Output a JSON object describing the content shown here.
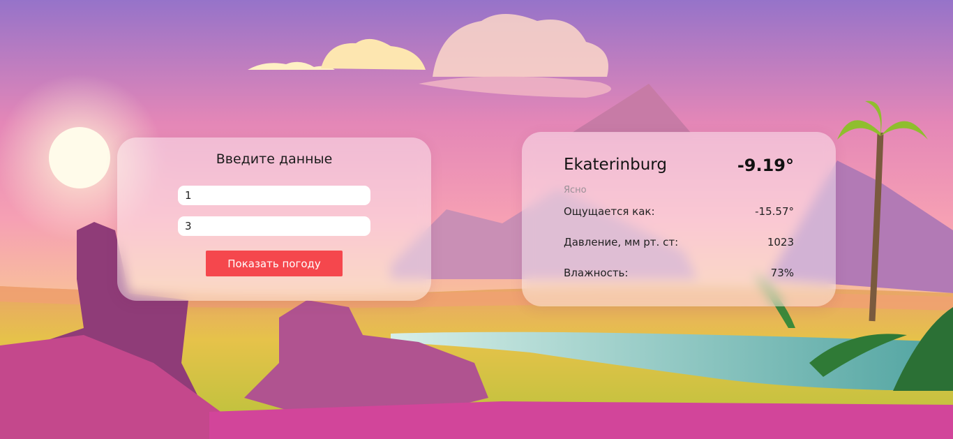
{
  "form": {
    "title": "Введите данные",
    "field_1_value": "1",
    "field_2_value": "3",
    "submit_label": "Показать погоду"
  },
  "weather": {
    "city": "Ekaterinburg",
    "temperature": "-9.19°",
    "description": "Ясно",
    "rows": [
      {
        "label": "Ощущается как:",
        "value": "-15.57°"
      },
      {
        "label": "Давление, мм рт. ст:",
        "value": "1023"
      },
      {
        "label": "Влажность:",
        "value": "73%"
      }
    ]
  },
  "colors": {
    "button": "#f5474d",
    "sky_top": "#9a72c8",
    "sky_mid": "#f29ab8",
    "horizon": "#f7b98a"
  }
}
